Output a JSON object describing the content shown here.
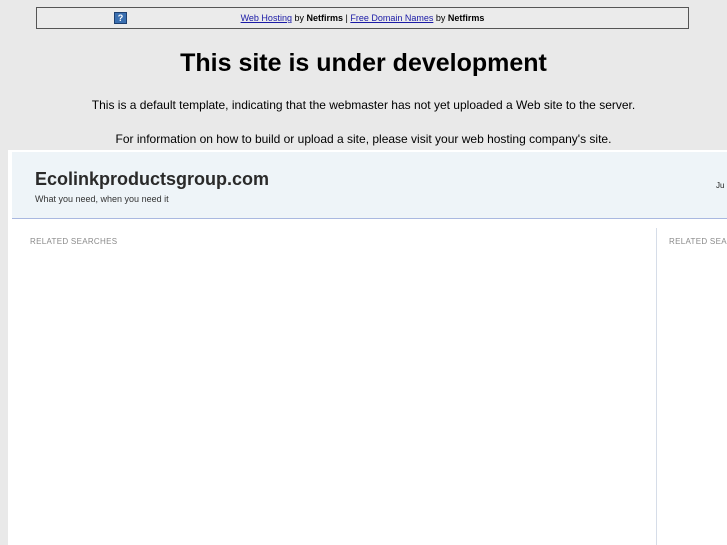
{
  "topbar": {
    "help_icon_glyph": "?",
    "link1": "Web Hosting",
    "by1": " by ",
    "brand1": "Netfirms",
    "separator": " | ",
    "link2": "Free Domain Names",
    "by2": " by ",
    "brand2": "Netfirms"
  },
  "main": {
    "headline": "This site is under development",
    "description": "This is a default template, indicating that the webmaster has not yet uploaded a Web site to the server.",
    "info": "For information on how to build or upload a site, please visit your web hosting company's site."
  },
  "frame": {
    "site_name": "Ecolinkproductsgroup.com",
    "tagline": "What you need, when you need it",
    "header_right": "Ju",
    "left_section_label": "RELATED SEARCHES",
    "right_section_label": "RELATED SEA"
  },
  "colors": {
    "link": "#1a1aa6",
    "page_bg": "#e9e9e9",
    "header_bg": "#eef4f8",
    "header_border": "#a9b8e0"
  }
}
